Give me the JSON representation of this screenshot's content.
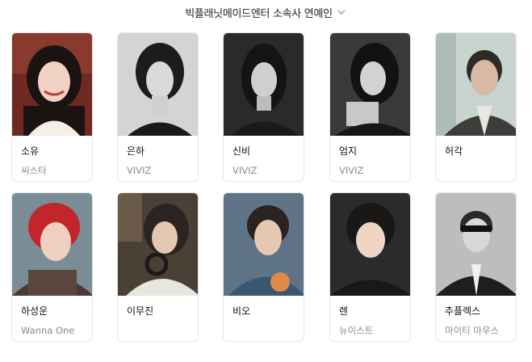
{
  "header": {
    "title": "빅플래닛메이드엔터 소속사 연예인",
    "dropdown_icon": "chevron-down-icon"
  },
  "artists": [
    {
      "name": "소유",
      "group": "씨스타",
      "photo": "portrait-color"
    },
    {
      "name": "은하",
      "group": "VIVIZ",
      "photo": "portrait-bw"
    },
    {
      "name": "신비",
      "group": "VIVIZ",
      "photo": "portrait-bw"
    },
    {
      "name": "엄지",
      "group": "VIVIZ",
      "photo": "portrait-bw"
    },
    {
      "name": "허각",
      "group": "",
      "photo": "portrait-color"
    },
    {
      "name": "하성운",
      "group": "Wanna One",
      "photo": "portrait-color"
    },
    {
      "name": "이무진",
      "group": "",
      "photo": "portrait-color"
    },
    {
      "name": "비오",
      "group": "",
      "photo": "portrait-color"
    },
    {
      "name": "렌",
      "group": "뉴이스트",
      "photo": "portrait-color"
    },
    {
      "name": "추플렉스",
      "group": "마이티 마우스",
      "photo": "portrait-bw"
    }
  ]
}
